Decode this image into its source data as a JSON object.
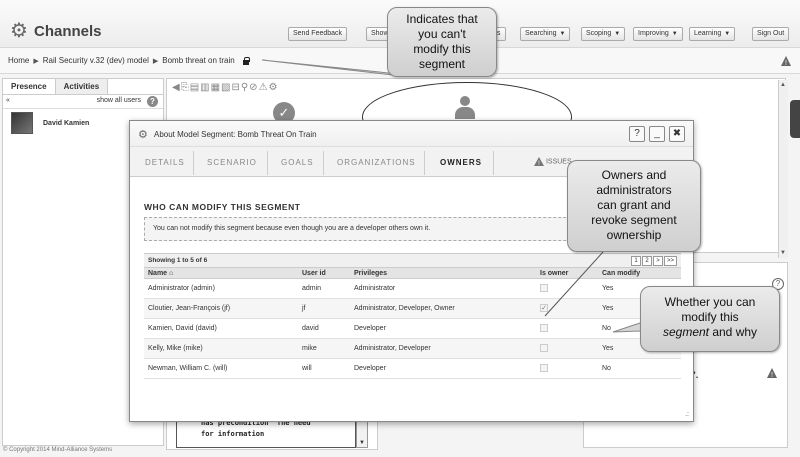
{
  "app": {
    "title": "Channels"
  },
  "toolbar": {
    "send_feedback": "Send Feedback",
    "show_hidden": "Show",
    "hidden_s": "s",
    "searching": "Searching",
    "scoping": "Scoping",
    "improving": "Improving",
    "learning": "Learning",
    "sign_out": "Sign Out"
  },
  "breadcrumb": {
    "home": "Home",
    "model": "Rail Security v.32 (dev) model",
    "segment": "Bomb threat on train"
  },
  "left_panel": {
    "tabs": [
      "Presence",
      "Activities"
    ],
    "collapse": "«",
    "show_all": "show all users",
    "users": [
      {
        "name": "David Kamien"
      }
    ]
  },
  "code_box": {
    "lines": [
      "has precondition 'The need",
      "for information"
    ]
  },
  "right_bottom": {
    "text": "g\"."
  },
  "footer": {
    "copyright": "© Copyright 2014 Mind-Alliance Systems"
  },
  "dialog": {
    "title": "About Model Segment: Bomb Threat On Train",
    "help": "?",
    "minimize": "_",
    "close": "✖",
    "tabs": [
      "DETAILS",
      "SCENARIO",
      "GOALS",
      "ORGANIZATIONS",
      "OWNERS"
    ],
    "active_tab": "OWNERS",
    "issues_label": "ISSUES",
    "section_title": "WHO CAN MODIFY THIS SEGMENT",
    "notice": "You can not modify this segment because even though you are a developer others own it.",
    "table": {
      "showing": "Showing 1 to 5 of 6",
      "pager": [
        "1",
        "2",
        ">",
        ">>"
      ],
      "columns": [
        "Name ⌂",
        "User id",
        "Privileges",
        "Is owner",
        "Can modify"
      ],
      "rows": [
        {
          "name": "Administrator (admin)",
          "user_id": "admin",
          "privileges": "Administrator",
          "is_owner": false,
          "can_modify": "Yes"
        },
        {
          "name": "Cloutier, Jean-François (jf)",
          "user_id": "jf",
          "privileges": "Administrator, Developer, Owner",
          "is_owner": true,
          "can_modify": "Yes"
        },
        {
          "name": "Kamien, David (david)",
          "user_id": "david",
          "privileges": "Developer",
          "is_owner": false,
          "can_modify": "No"
        },
        {
          "name": "Kelly, Mike (mike)",
          "user_id": "mike",
          "privileges": "Administrator, Developer",
          "is_owner": false,
          "can_modify": "Yes"
        },
        {
          "name": "Newman, William C. (will)",
          "user_id": "will",
          "privileges": "Developer",
          "is_owner": false,
          "can_modify": "No"
        }
      ]
    }
  },
  "callouts": {
    "lock": [
      "Indicates that",
      "you can't",
      "modify this",
      "segment"
    ],
    "owners": [
      "Owners and",
      "administrators",
      "can grant and",
      "revoke segment",
      "ownership"
    ],
    "modify_line1": "Whether you can",
    "modify_line2": "modify this",
    "modify_line3_italic": "segment",
    "modify_line3_rest": " and why"
  },
  "colors": {
    "callout_bg": "#dcdcdc",
    "accent": "#333333"
  }
}
